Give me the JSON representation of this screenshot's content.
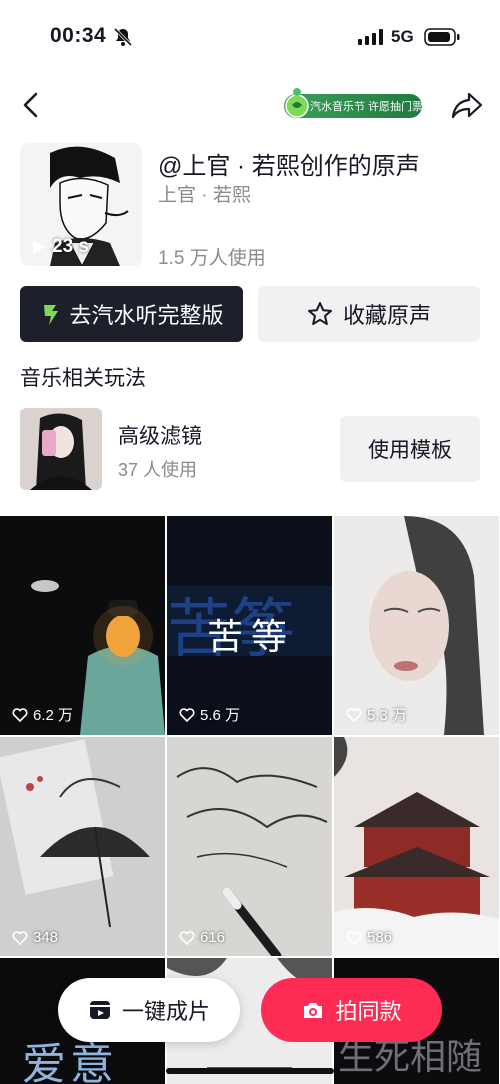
{
  "status_bar": {
    "time": "00:34",
    "network": "5G",
    "icons": [
      "bell-muted-icon",
      "signal-icon",
      "battery-icon"
    ]
  },
  "nav": {
    "back_icon": "chevron-left-icon",
    "promo_text": "汽水音乐节 许愿抽门票",
    "share_icon": "share-arrow-icon"
  },
  "sound": {
    "duration": "23 s",
    "title": "@上官 · 若熙创作的原声",
    "author": "上官 · 若熙",
    "usage": "1.5 万人使用"
  },
  "actions": {
    "listen_full_label": "去汽水听完整版",
    "favorite_label": "收藏原声"
  },
  "section": {
    "title": "音乐相关玩法"
  },
  "template": {
    "name": "高级滤镜",
    "usage": "37 人使用",
    "button_label": "使用模板"
  },
  "videos": [
    {
      "likes": "6.2 万",
      "overlay": ""
    },
    {
      "likes": "5.6 万",
      "overlay": "苦等"
    },
    {
      "likes": "5.3 万",
      "overlay": ""
    },
    {
      "likes": "348",
      "overlay": ""
    },
    {
      "likes": "616",
      "overlay": ""
    },
    {
      "likes": "586",
      "overlay": ""
    },
    {
      "likes": "",
      "overlay": "爱意"
    },
    {
      "likes": "",
      "overlay": ""
    },
    {
      "likes": "",
      "overlay": "生死相随"
    }
  ],
  "bottom": {
    "oneclick_label": "一键成片",
    "same_label": "拍同款"
  },
  "colors": {
    "accent_red": "#fe2c55",
    "dark_button": "#1d1f2b",
    "muted_text": "#8a8b91"
  }
}
